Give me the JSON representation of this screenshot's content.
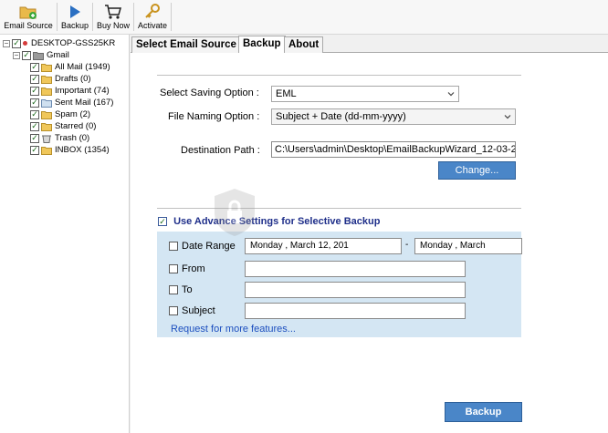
{
  "toolbar": {
    "items": [
      {
        "label": "Email Source",
        "icon": "folder-add-icon"
      },
      {
        "label": "Backup",
        "icon": "play-icon"
      },
      {
        "label": "Buy Now",
        "icon": "cart-icon"
      },
      {
        "label": "Activate",
        "icon": "key-icon"
      }
    ]
  },
  "tree": {
    "root": "DESKTOP-GSS25KR",
    "account": "Gmail",
    "folders": [
      "All Mail (1949)",
      "Drafts (0)",
      "Important (74)",
      "Sent Mail (167)",
      "Spam (2)",
      "Starred (0)",
      "Trash (0)",
      "INBOX (1354)"
    ]
  },
  "tabs": [
    {
      "label": "Select Email Source",
      "active": false
    },
    {
      "label": "Backup",
      "active": true
    },
    {
      "label": "About",
      "active": false
    }
  ],
  "backup": {
    "saving_option_label": "Select Saving Option :",
    "saving_option_value": "EML",
    "naming_option_label": "File Naming Option :",
    "naming_option_value": "Subject + Date (dd-mm-yyyy)",
    "destination_label": "Destination Path :",
    "destination_value": "C:\\Users\\admin\\Desktop\\EmailBackupWizard_12-03-2",
    "change_button": "Change...",
    "advance_label": "Use Advance Settings for Selective Backup",
    "date_range_label": "Date Range",
    "date_from": "Monday  ,   March   12, 201",
    "date_to": "Monday  ,   March",
    "date_sep": "-",
    "from_label": "From",
    "to_label": "To",
    "subject_label": "Subject",
    "request_link": "Request for more features...",
    "backup_button": "Backup"
  },
  "colors": {
    "accent": "#4a86c8",
    "panel": "#d4e6f3",
    "link": "#1c4fbf"
  }
}
